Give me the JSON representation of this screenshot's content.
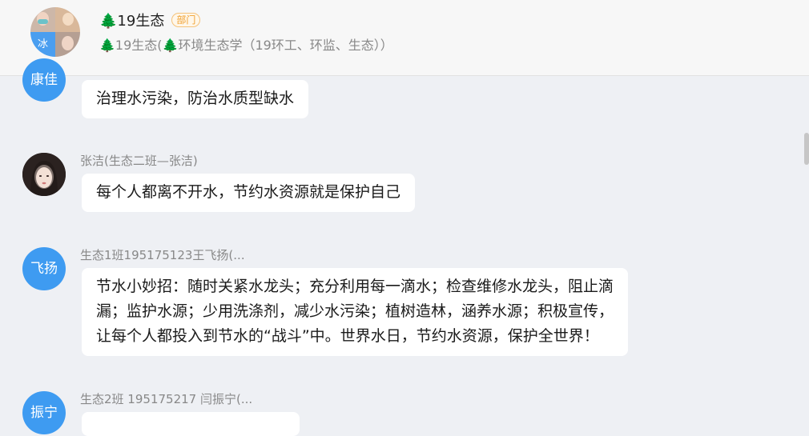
{
  "header": {
    "title": "🌲19生态",
    "badge": "部门",
    "subtitle": "🌲19生态(🌲环境生态学（19环工、环监、生态））",
    "avatar_char": "冰"
  },
  "messages": [
    {
      "avatar_text": "康佳",
      "sender": "",
      "text": "治理水污染，防治水质型缺水"
    },
    {
      "avatar_text": "",
      "sender": "张洁(生态二班—张洁)",
      "text": "每个人都离不开水，节约水资源就是保护自己"
    },
    {
      "avatar_text": "飞扬",
      "sender": "生态1班195175123王飞扬(...",
      "text_lines": [
        "节水小妙招：随时关紧水龙头；充分利用每一滴水；检查维修水龙头，阻止滴",
        "漏；监护水源；少用洗涤剂，减少水污染；植树造林，涵养水源；积极宣传，",
        "让每个人都投入到节水的“战斗”中。世界水日，节约水资源，保护全世界！"
      ]
    },
    {
      "avatar_text": "振宁",
      "sender": "生态2班 195175217 闫振宁(...",
      "text": ""
    }
  ],
  "colors": {
    "avatar_blue": "#3e9bf1",
    "bubble": "#ffffff",
    "background": "#eef0f4"
  }
}
